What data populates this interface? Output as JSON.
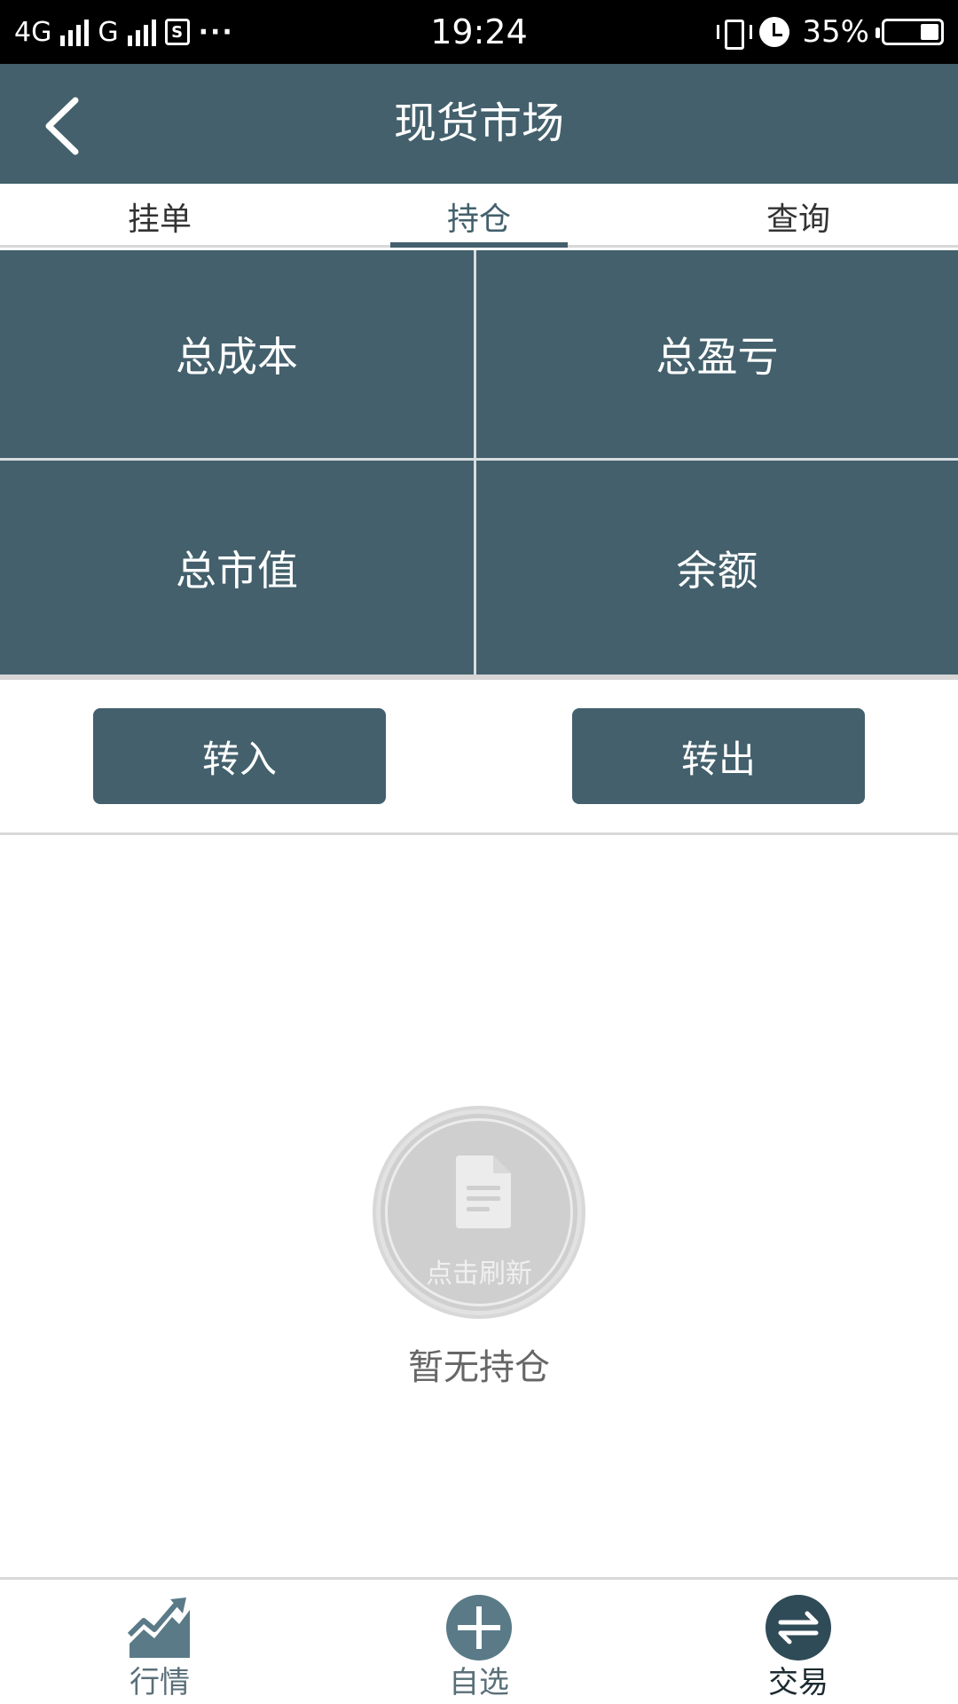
{
  "status_bar": {
    "network_1": "4G",
    "network_2": "G",
    "sim_label": "S",
    "more": "···",
    "time": "19:24",
    "battery": "35%",
    "battery_level": 0.35
  },
  "header": {
    "title": "现货市场"
  },
  "tabs": [
    {
      "label": "挂单"
    },
    {
      "label": "持仓"
    },
    {
      "label": "查询"
    }
  ],
  "summary": {
    "total_cost": "总成本",
    "total_pnl": "总盈亏",
    "total_market_value": "总市值",
    "balance": "余额"
  },
  "actions": {
    "transfer_in": "转入",
    "transfer_out": "转出"
  },
  "empty_state": {
    "refresh_label": "点击刷新",
    "message": "暂无持仓"
  },
  "bottom_nav": [
    {
      "label": "行情",
      "icon": "chart-trend-icon"
    },
    {
      "label": "自选",
      "icon": "plus-circle-icon"
    },
    {
      "label": "交易",
      "icon": "exchange-arrows-icon"
    }
  ],
  "colors": {
    "primary": "#43606c",
    "background": "#ffffff",
    "divider": "#d8d8d8",
    "empty_gray": "#cfcfcf"
  }
}
